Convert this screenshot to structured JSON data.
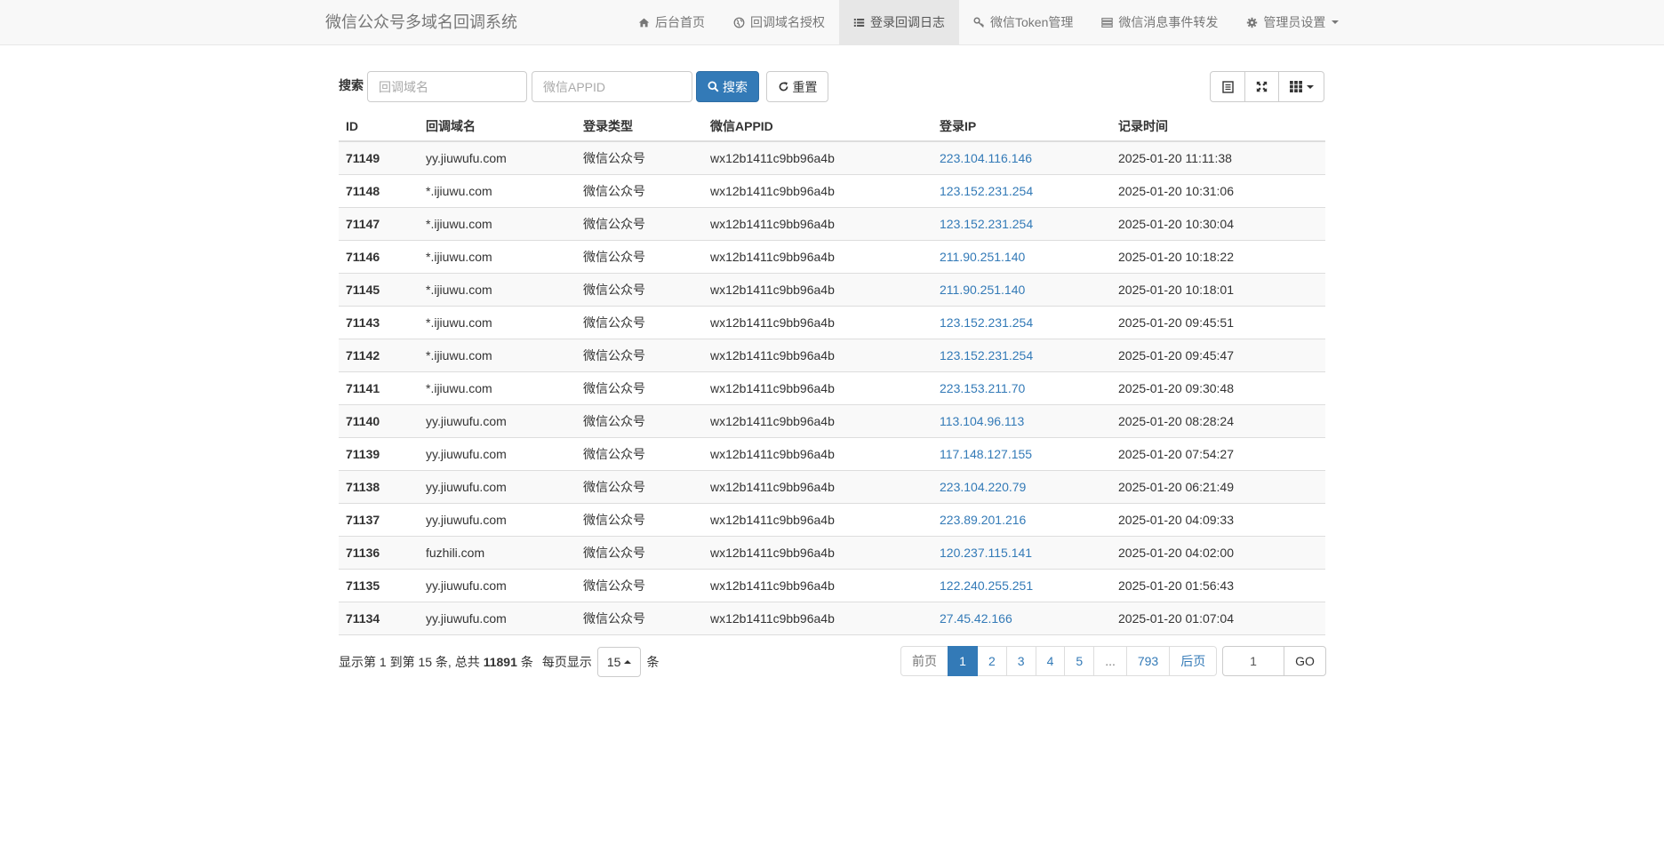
{
  "navbar": {
    "brand": "微信公众号多域名回调系统",
    "items": [
      {
        "label": "后台首页",
        "icon": "home-icon",
        "active": false
      },
      {
        "label": "回调域名授权",
        "icon": "globe-icon",
        "active": false
      },
      {
        "label": "登录回调日志",
        "icon": "list-icon",
        "active": true
      },
      {
        "label": "微信Token管理",
        "icon": "key-icon",
        "active": false
      },
      {
        "label": "微信消息事件转发",
        "icon": "tasks-icon",
        "active": false
      },
      {
        "label": "管理员设置",
        "icon": "gear-icon",
        "active": false,
        "dropdown": true
      }
    ]
  },
  "toolbar": {
    "search_label": "搜索",
    "domain_placeholder": "回调域名",
    "appid_placeholder": "微信APPID",
    "search_button": "搜索",
    "reset_button": "重置"
  },
  "table": {
    "columns": [
      "ID",
      "回调域名",
      "登录类型",
      "微信APPID",
      "登录IP",
      "记录时间"
    ],
    "rows": [
      [
        "71149",
        "yy.jiuwufu.com",
        "微信公众号",
        "wx12b1411c9bb96a4b",
        "223.104.116.146",
        "2025-01-20 11:11:38"
      ],
      [
        "71148",
        "*.ijiuwu.com",
        "微信公众号",
        "wx12b1411c9bb96a4b",
        "123.152.231.254",
        "2025-01-20 10:31:06"
      ],
      [
        "71147",
        "*.ijiuwu.com",
        "微信公众号",
        "wx12b1411c9bb96a4b",
        "123.152.231.254",
        "2025-01-20 10:30:04"
      ],
      [
        "71146",
        "*.ijiuwu.com",
        "微信公众号",
        "wx12b1411c9bb96a4b",
        "211.90.251.140",
        "2025-01-20 10:18:22"
      ],
      [
        "71145",
        "*.ijiuwu.com",
        "微信公众号",
        "wx12b1411c9bb96a4b",
        "211.90.251.140",
        "2025-01-20 10:18:01"
      ],
      [
        "71143",
        "*.ijiuwu.com",
        "微信公众号",
        "wx12b1411c9bb96a4b",
        "123.152.231.254",
        "2025-01-20 09:45:51"
      ],
      [
        "71142",
        "*.ijiuwu.com",
        "微信公众号",
        "wx12b1411c9bb96a4b",
        "123.152.231.254",
        "2025-01-20 09:45:47"
      ],
      [
        "71141",
        "*.ijiuwu.com",
        "微信公众号",
        "wx12b1411c9bb96a4b",
        "223.153.211.70",
        "2025-01-20 09:30:48"
      ],
      [
        "71140",
        "yy.jiuwufu.com",
        "微信公众号",
        "wx12b1411c9bb96a4b",
        "113.104.96.113",
        "2025-01-20 08:28:24"
      ],
      [
        "71139",
        "yy.jiuwufu.com",
        "微信公众号",
        "wx12b1411c9bb96a4b",
        "117.148.127.155",
        "2025-01-20 07:54:27"
      ],
      [
        "71138",
        "yy.jiuwufu.com",
        "微信公众号",
        "wx12b1411c9bb96a4b",
        "223.104.220.79",
        "2025-01-20 06:21:49"
      ],
      [
        "71137",
        "yy.jiuwufu.com",
        "微信公众号",
        "wx12b1411c9bb96a4b",
        "223.89.201.216",
        "2025-01-20 04:09:33"
      ],
      [
        "71136",
        "fuzhili.com",
        "微信公众号",
        "wx12b1411c9bb96a4b",
        "120.237.115.141",
        "2025-01-20 04:02:00"
      ],
      [
        "71135",
        "yy.jiuwufu.com",
        "微信公众号",
        "wx12b1411c9bb96a4b",
        "122.240.255.251",
        "2025-01-20 01:56:43"
      ],
      [
        "71134",
        "yy.jiuwufu.com",
        "微信公众号",
        "wx12b1411c9bb96a4b",
        "27.45.42.166",
        "2025-01-20 01:07:04"
      ]
    ]
  },
  "footer": {
    "info_prefix": "显示第 1 到第 15 条, 总共",
    "total": "11891",
    "info_suffix": "条",
    "per_page_label": "每页显示",
    "page_size": "15",
    "per_page_suffix": "条",
    "pages": [
      {
        "label": "前页",
        "state": "disabled"
      },
      {
        "label": "1",
        "state": "active"
      },
      {
        "label": "2",
        "state": "normal"
      },
      {
        "label": "3",
        "state": "normal"
      },
      {
        "label": "4",
        "state": "normal"
      },
      {
        "label": "5",
        "state": "normal"
      },
      {
        "label": "...",
        "state": "disabled"
      },
      {
        "label": "793",
        "state": "normal"
      },
      {
        "label": "后页",
        "state": "normal"
      }
    ],
    "goto_value": "1",
    "goto_button": "GO"
  },
  "colors": {
    "primary": "#337ab7",
    "navbar_bg": "#f8f8f8",
    "active_nav_bg": "#e7e7e7"
  }
}
